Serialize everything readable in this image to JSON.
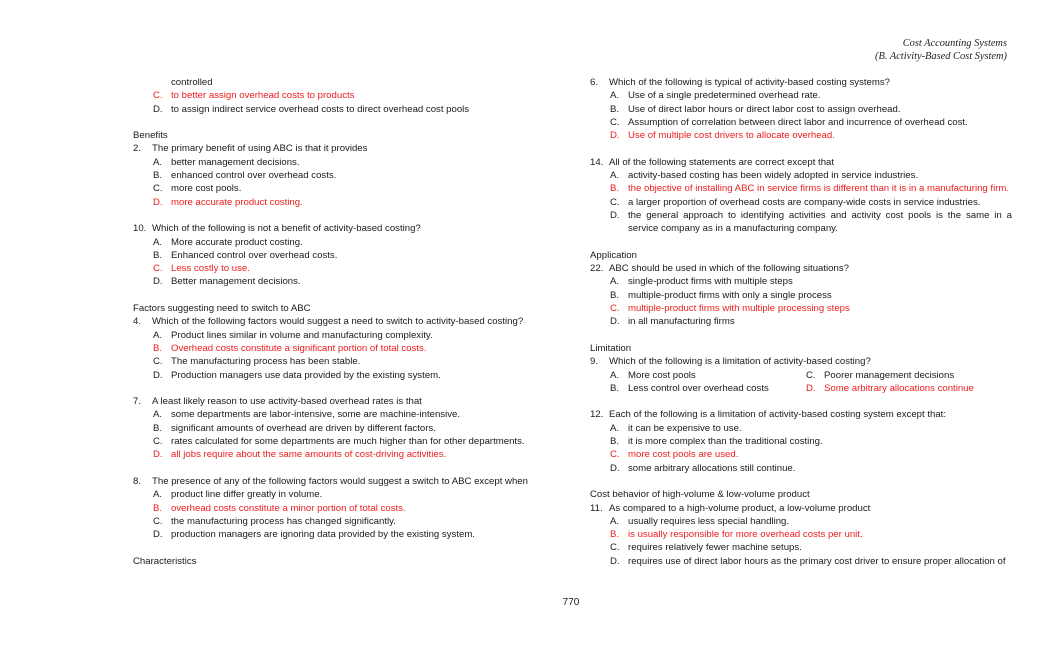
{
  "header": {
    "line1": "Cost Accounting Systems",
    "line2": "(B. Activity-Based Cost System)"
  },
  "left": {
    "continued": {
      "tail": "controlled",
      "options": [
        {
          "letter": "C.",
          "text": "to better assign overhead costs to products",
          "correct": true
        },
        {
          "letter": "D.",
          "text": "to assign indirect service overhead costs to direct overhead cost pools",
          "correct": false
        }
      ]
    },
    "sections": [
      {
        "title": "Benefits",
        "questions": [
          {
            "num": "2.",
            "text": "The primary benefit of using ABC is that it provides",
            "options": [
              {
                "letter": "A.",
                "text": "better management decisions.",
                "correct": false
              },
              {
                "letter": "B.",
                "text": "enhanced control over overhead costs.",
                "correct": false
              },
              {
                "letter": "C.",
                "text": "more cost pools.",
                "correct": false
              },
              {
                "letter": "D.",
                "text": "more accurate product costing.",
                "correct": true
              }
            ]
          },
          {
            "num": "10.",
            "text": "Which of the following is not a benefit of activity-based costing?",
            "options": [
              {
                "letter": "A.",
                "text": "More accurate product costing.",
                "correct": false
              },
              {
                "letter": "B.",
                "text": "Enhanced control over overhead costs.",
                "correct": false
              },
              {
                "letter": "C.",
                "text": "Less costly to use.",
                "correct": true
              },
              {
                "letter": "D.",
                "text": "Better management decisions.",
                "correct": false
              }
            ]
          }
        ]
      },
      {
        "title": "Factors suggesting need to switch to ABC",
        "questions": [
          {
            "num": "4.",
            "text": "Which of the following factors would suggest a need to switch to activity-based costing?",
            "options": [
              {
                "letter": "A.",
                "text": "Product lines similar in volume and manufacturing complexity.",
                "correct": false
              },
              {
                "letter": "B.",
                "text": "Overhead costs constitute a significant portion of total costs.",
                "correct": true
              },
              {
                "letter": "C.",
                "text": "The manufacturing process has been stable.",
                "correct": false
              },
              {
                "letter": "D.",
                "text": "Production managers use data provided by the existing system.",
                "correct": false
              }
            ]
          },
          {
            "num": "7.",
            "text": "A least likely reason to use activity-based overhead rates is that",
            "options": [
              {
                "letter": "A.",
                "text": "some departments are labor-intensive, some are machine-intensive.",
                "correct": false
              },
              {
                "letter": "B.",
                "text": "significant amounts of overhead are driven by different factors.",
                "correct": false
              },
              {
                "letter": "C.",
                "text": "rates calculated for some departments are much higher than for other departments.",
                "correct": false
              },
              {
                "letter": "D.",
                "text": "all jobs require about the same amounts of cost-driving activities.",
                "correct": true
              }
            ]
          },
          {
            "num": "8.",
            "text": "The presence of any of the following factors would suggest a switch to ABC except when",
            "options": [
              {
                "letter": "A.",
                "text": "product line differ greatly in volume.",
                "correct": false
              },
              {
                "letter": "B.",
                "text": "overhead costs constitute a minor portion of total costs.",
                "correct": true
              },
              {
                "letter": "C.",
                "text": "the manufacturing process has changed significantly.",
                "correct": false
              },
              {
                "letter": "D.",
                "text": "production managers are ignoring data provided by the existing system.",
                "correct": false
              }
            ]
          }
        ]
      },
      {
        "title": "Characteristics",
        "questions": []
      }
    ]
  },
  "right": {
    "sections": [
      {
        "title": "",
        "questions": [
          {
            "num": "6.",
            "text": "Which of the following is typical of activity-based costing systems?",
            "options": [
              {
                "letter": "A.",
                "text": "Use of a single predetermined overhead rate.",
                "correct": false
              },
              {
                "letter": "B.",
                "text": "Use of direct labor hours or direct labor cost to assign overhead.",
                "correct": false
              },
              {
                "letter": "C.",
                "text": "Assumption of correlation between direct labor and incurrence of overhead cost.",
                "correct": false
              },
              {
                "letter": "D.",
                "text": "Use of multiple cost drivers to allocate overhead.",
                "correct": true
              }
            ]
          },
          {
            "num": "14.",
            "text": "All of the following statements are correct except that",
            "options": [
              {
                "letter": "A.",
                "text": "activity-based costing has been widely adopted in service industries.",
                "correct": false
              },
              {
                "letter": "B.",
                "text": "the objective of installing ABC in service firms is different than it is in a manufacturing firm.",
                "correct": true
              },
              {
                "letter": "C.",
                "text": "a larger proportion of overhead costs are company-wide costs in service industries.",
                "correct": false
              },
              {
                "letter": "D.",
                "text": "the general approach to identifying activities and activity cost pools is the same in a",
                "continuation": "service company as in a manufacturing company.",
                "correct": false
              }
            ]
          }
        ]
      },
      {
        "title": "Application",
        "questions": [
          {
            "num": "22.",
            "text": "ABC should be used in which of the following situations?",
            "options": [
              {
                "letter": "A.",
                "text": "single-product firms with multiple steps",
                "correct": false
              },
              {
                "letter": "B.",
                "text": "multiple-product firms with only a single process",
                "correct": false
              },
              {
                "letter": "C.",
                "text": "multiple-product firms with multiple processing steps",
                "correct": true
              },
              {
                "letter": "D.",
                "text": "in all manufacturing firms",
                "correct": false
              }
            ]
          }
        ]
      },
      {
        "title": "Limitation",
        "questions": [
          {
            "num": "9.",
            "text": "Which of the following is a limitation of activity-based costing?",
            "layout": "two-col",
            "options": [
              {
                "letter": "A.",
                "text": "More cost pools",
                "correct": false
              },
              {
                "letter": "C.",
                "text": "Poorer management decisions",
                "correct": false
              },
              {
                "letter": "B.",
                "text": "Less control over overhead costs",
                "correct": false
              },
              {
                "letter": "D.",
                "text": "Some arbitrary allocations continue",
                "correct": true
              }
            ]
          },
          {
            "num": "12.",
            "text": "Each of the following is a limitation of activity-based costing system except that:",
            "options": [
              {
                "letter": "A.",
                "text": "it can be expensive to use.",
                "correct": false
              },
              {
                "letter": "B.",
                "text": "it is more complex than the traditional costing.",
                "correct": false
              },
              {
                "letter": "C.",
                "text": "more cost pools are used.",
                "correct": true
              },
              {
                "letter": "D.",
                "text": "some arbitrary allocations still continue.",
                "correct": false
              }
            ]
          }
        ]
      },
      {
        "title": "Cost behavior of high-volume & low-volume product",
        "questions": [
          {
            "num": "11.",
            "text": "As compared to a high-volume product, a low-volume product",
            "options": [
              {
                "letter": "A.",
                "text": "usually requires less special handling.",
                "correct": false
              },
              {
                "letter": "B.",
                "text": "is usually responsible for more overhead costs per unit.",
                "correct": true
              },
              {
                "letter": "C.",
                "text": "requires relatively fewer machine setups.",
                "correct": false
              },
              {
                "letter": "D.",
                "text": "requires use of direct labor hours as the primary cost driver to ensure proper allocation of",
                "correct": false
              }
            ]
          }
        ]
      }
    ]
  },
  "footer": {
    "page_number": "770"
  },
  "colors": {
    "correct_answer": "#ee1c1c",
    "text": "#1a1a1a"
  }
}
